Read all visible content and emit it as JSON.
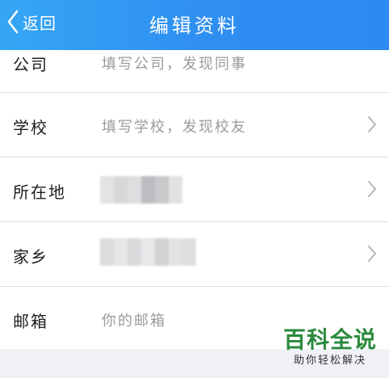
{
  "nav": {
    "back_label": "返回",
    "title": "编辑资料"
  },
  "rows": [
    {
      "label": "公司",
      "placeholder": "填写公司，发现同事",
      "has_chevron": false
    },
    {
      "label": "学校",
      "placeholder": "填写学校，发现校友",
      "has_chevron": true
    },
    {
      "label": "所在地",
      "placeholder": "",
      "has_chevron": true,
      "value_obscured": true
    },
    {
      "label": "家乡",
      "placeholder": "",
      "has_chevron": true,
      "value_obscured": true
    },
    {
      "label": "邮箱",
      "placeholder": "你的邮箱",
      "has_chevron": false
    }
  ],
  "watermark": {
    "main": "百科全说",
    "sub": "助你轻松解决"
  },
  "colors": {
    "nav_bar": "#2f8ef2",
    "label_text": "#1e1e1e",
    "placeholder_text": "#9b9ba0",
    "divider": "#dcdce0",
    "watermark_green": "#2a8a3c"
  },
  "icons": {
    "back": "chevron-left-icon",
    "row_disclosure": "chevron-right-icon"
  }
}
